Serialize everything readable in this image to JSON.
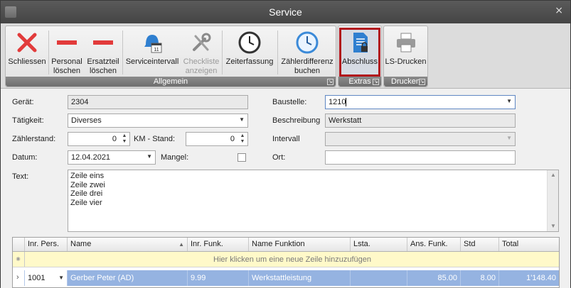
{
  "window": {
    "title": "Service",
    "close_glyph": "×"
  },
  "ribbon": {
    "buttons": [
      {
        "line1": "Schliessen",
        "line2": "",
        "icon": "close-x-icon",
        "disabled": false
      },
      {
        "line1": "Personal",
        "line2": "löschen",
        "icon": "minus-icon",
        "disabled": false
      },
      {
        "line1": "Ersatzteil",
        "line2": "löschen",
        "icon": "minus-icon",
        "disabled": false
      },
      {
        "line1": "Serviceintervall",
        "line2": "",
        "icon": "calendar-bell-icon",
        "disabled": false
      },
      {
        "line1": "Checkliste",
        "line2": "anzeigen",
        "icon": "wrench-tools-icon",
        "disabled": true
      },
      {
        "line1": "Zeiterfassung",
        "line2": "",
        "icon": "clock-icon",
        "disabled": false
      },
      {
        "line1": "Zählerdifferenz",
        "line2": "buchen",
        "icon": "clock-blue-icon",
        "disabled": false
      },
      {
        "line1": "Abschluss",
        "line2": "",
        "icon": "document-lock-icon",
        "disabled": false,
        "selected": true
      },
      {
        "line1": "LS-Drucken",
        "line2": "",
        "icon": "printer-icon",
        "disabled": false
      }
    ],
    "groups": [
      "Allgemein",
      "Extras",
      "Drucken"
    ]
  },
  "form": {
    "geraet_label": "Gerät:",
    "geraet_value": "2304",
    "taetigkeit_label": "Tätigkeit:",
    "taetigkeit_value": "Diverses",
    "zaehlerstand_label": "Zählerstand:",
    "zaehlerstand_value": "0",
    "km_label": "KM - Stand:",
    "km_value": "0",
    "datum_label": "Datum:",
    "datum_value": "12.04.2021",
    "mangel_label": "Mangel:",
    "baustelle_label": "Baustelle:",
    "baustelle_value": "1210",
    "beschreibung_label": "Beschreibung",
    "beschreibung_value": "Werkstatt",
    "intervall_label": "Intervall",
    "intervall_value": "",
    "ort_label": "Ort:",
    "ort_value": "",
    "text_label": "Text:",
    "text_lines": [
      "Zeile eins",
      "Zeile zwei",
      "Zeile drei",
      "Zeile vier"
    ]
  },
  "grid": {
    "columns": [
      "Inr. Pers.",
      "Name",
      "Inr. Funk.",
      "Name Funktion",
      "Lsta.",
      "Ans. Funk.",
      "Std",
      "Total"
    ],
    "new_row_hint": "Hier klicken um eine neue Zeile hinzuzufügen",
    "rows": [
      {
        "inr_pers": "1001",
        "name": "Gerber Peter (AD)",
        "inr_funk": "9.99",
        "name_funktion": "Werkstattleistung",
        "lsta": "",
        "ans_funk": "85.00",
        "std": "8.00",
        "total": "1'148.40"
      }
    ]
  }
}
